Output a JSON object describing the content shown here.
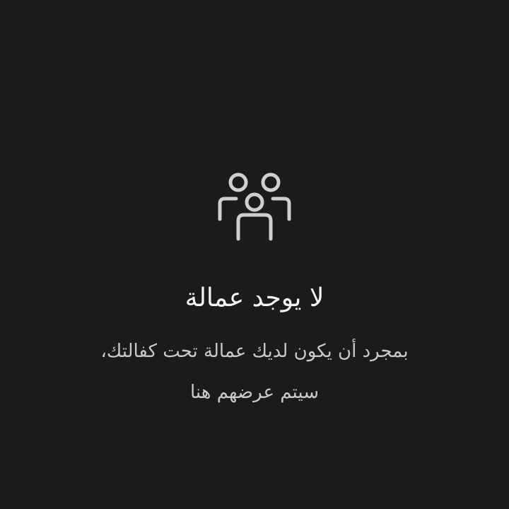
{
  "empty_state": {
    "icon": "people-group-icon",
    "title": "لا يوجد عمالة",
    "message_lines": [
      "بمجرد أن يكون لديك عمالة تحت كفالتك،",
      "سيتم عرضهم هنا"
    ]
  },
  "colors": {
    "background": "#1b1b1b",
    "icon": "#cfcfcf",
    "title": "#f4f4f4",
    "message": "#c9c9c9"
  }
}
